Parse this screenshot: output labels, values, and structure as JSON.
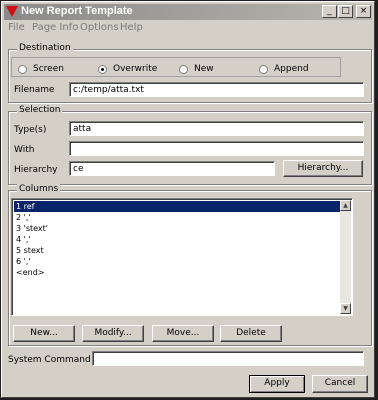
{
  "window": {
    "title": "New Report Template",
    "controls": {
      "minimize": "_",
      "maximize": "□",
      "close": "×"
    }
  },
  "menu": [
    "File",
    "Page Info",
    "Options",
    "Help"
  ],
  "destination": {
    "label": "Destination",
    "options": [
      "Screen",
      "Overwrite",
      "New",
      "Append"
    ],
    "selected": "Overwrite",
    "filename_label": "Filename",
    "filename": "c:/temp/atta.txt"
  },
  "selection": {
    "label": "Selection",
    "types_label": "Type(s)",
    "types": "atta",
    "with_label": "With",
    "with": "",
    "hierarchy_label": "Hierarchy",
    "hierarchy": "ce",
    "hierarchy_button": "Hierarchy..."
  },
  "columns": {
    "label": "Columns",
    "items": [
      "1  ref",
      "2  ','",
      "3  'stext'",
      "4  ','",
      "5  stext",
      "6  ','",
      "<end>"
    ],
    "selected_index": 0,
    "buttons": {
      "new": "New...",
      "modify": "Modify...",
      "move": "Move...",
      "delete": "Delete"
    }
  },
  "system_command": {
    "label": "System Command",
    "value": ""
  },
  "footer": {
    "apply": "Apply",
    "cancel": "Cancel"
  },
  "colors": {
    "titlebar": "#8a8a8a",
    "selection": "#0a246a",
    "face": "#d4d0c8",
    "logo": "#d01010"
  }
}
